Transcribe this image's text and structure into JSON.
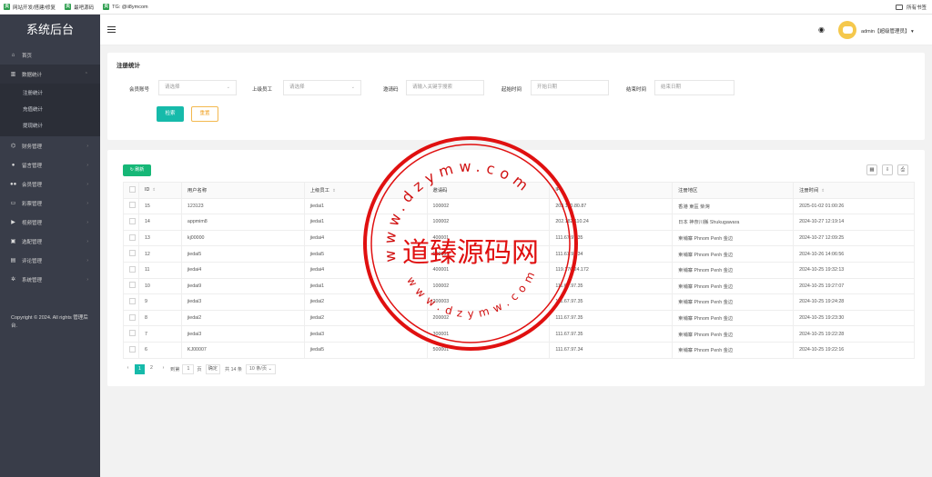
{
  "bookmarks": [
    {
      "label": "网站开发/搭建/修复",
      "icon": "site-icon"
    },
    {
      "label": "最吧源码",
      "icon": "site-icon"
    },
    {
      "label": "TG: @ii8ymcom",
      "icon": "site-icon"
    }
  ],
  "bookmarks_right": "所有书签",
  "sidebar": {
    "logo": "系统后台",
    "items": [
      {
        "label": "首页",
        "icon": "home-icon"
      },
      {
        "label": "数据统计",
        "icon": "chart-icon"
      },
      {
        "label": "财务管理",
        "icon": "bank-icon"
      },
      {
        "label": "留言管理",
        "icon": "user-icon"
      },
      {
        "label": "会员管理",
        "icon": "users-icon"
      },
      {
        "label": "彩票管理",
        "icon": "ticket-icon"
      },
      {
        "label": "视频管理",
        "icon": "video-icon"
      },
      {
        "label": "选配管理",
        "icon": "shop-icon"
      },
      {
        "label": "评论管理",
        "icon": "comment-icon"
      },
      {
        "label": "系统管理",
        "icon": "gear-icon"
      }
    ],
    "sub_items": [
      "注册统计",
      "充值统计",
      "提现统计"
    ],
    "copyright": "Copyright © 2024. All rights 管理后台."
  },
  "header": {
    "user": "admin【超级管理员】"
  },
  "filter": {
    "title": "注册统计",
    "member_label": "会员账号",
    "member_placeholder": "请选择",
    "superior_label": "上级员工",
    "superior_placeholder": "请选择",
    "invite_label": "邀请码",
    "invite_placeholder": "请输入关键字搜索",
    "start_label": "起始时间",
    "start_placeholder": "开始日期",
    "end_label": "结束时间",
    "end_placeholder": "结束日期",
    "search_label": "检索",
    "reset_label": "重置"
  },
  "table": {
    "refresh_label": "刷新",
    "columns": [
      "ID",
      "用户名称",
      "上级员工",
      "邀请码",
      "IP",
      "注册地区",
      "注册时间"
    ],
    "rows": [
      [
        "15",
        "123123",
        "jiedai1",
        "100002",
        "203.160.80.87",
        "香港 東區 柴灣",
        "2025-01-02 01:00:26"
      ],
      [
        "14",
        "appmim8",
        "jiedai1",
        "100002",
        "202.182.110.24",
        "日本 神奈川縣 Shukugawara",
        "2024-10-27 12:19:14"
      ],
      [
        "13",
        "kj00000",
        "jiedai4",
        "400001",
        "111.67.97.35",
        "柬埔寨 Phnom Penh 金边",
        "2024-10-27 12:09:25"
      ],
      [
        "12",
        "jiedai5",
        "jiedai5",
        "500001",
        "111.67.97.34",
        "柬埔寨 Phnom Penh 金边",
        "2024-10-26 14:06:56"
      ],
      [
        "11",
        "jiedai4",
        "jiedai4",
        "400001",
        "119.176.24.172",
        "柬埔寨 Phnom Penh 金边",
        "2024-10-25 19:32:13"
      ],
      [
        "10",
        "jiedai9",
        "jiedai1",
        "100002",
        "111.67.97.35",
        "柬埔寨 Phnom Penh 金边",
        "2024-10-25 19:27:07"
      ],
      [
        "9",
        "jiedai3",
        "jiedai2",
        "200003",
        "111.67.97.35",
        "柬埔寨 Phnom Penh 金边",
        "2024-10-25 19:24:28"
      ],
      [
        "8",
        "jiedai2",
        "jiedai2",
        "200002",
        "111.67.97.35",
        "柬埔寨 Phnom Penh 金边",
        "2024-10-25 19:23:30"
      ],
      [
        "7",
        "jiedai3",
        "jiedai3",
        "300001",
        "111.67.97.35",
        "柬埔寨 Phnom Penh 金边",
        "2024-10-25 19:22:28"
      ],
      [
        "6",
        "KJ00007",
        "jiedai5",
        "500001",
        "111.67.97.34",
        "柬埔寨 Phnom Penh 金边",
        "2024-10-25 19:22:16"
      ]
    ]
  },
  "pager": {
    "prev": "‹",
    "pages": [
      "1",
      "2"
    ],
    "next": "›",
    "goto_prefix": "到第",
    "goto_value": "1",
    "goto_suffix": "页",
    "confirm": "确定",
    "total": "共 14 条",
    "per_page": "10 条/页"
  },
  "watermark": {
    "center": "道臻源码网",
    "ring_top": "www.dzymw.com",
    "ring_bottom": "www.dzymw.com"
  },
  "colors": {
    "sidebar": "#393d49",
    "accent": "#16baaa",
    "refresh": "#16b777",
    "reset": "#f0a020",
    "stamp": "#e01010"
  }
}
